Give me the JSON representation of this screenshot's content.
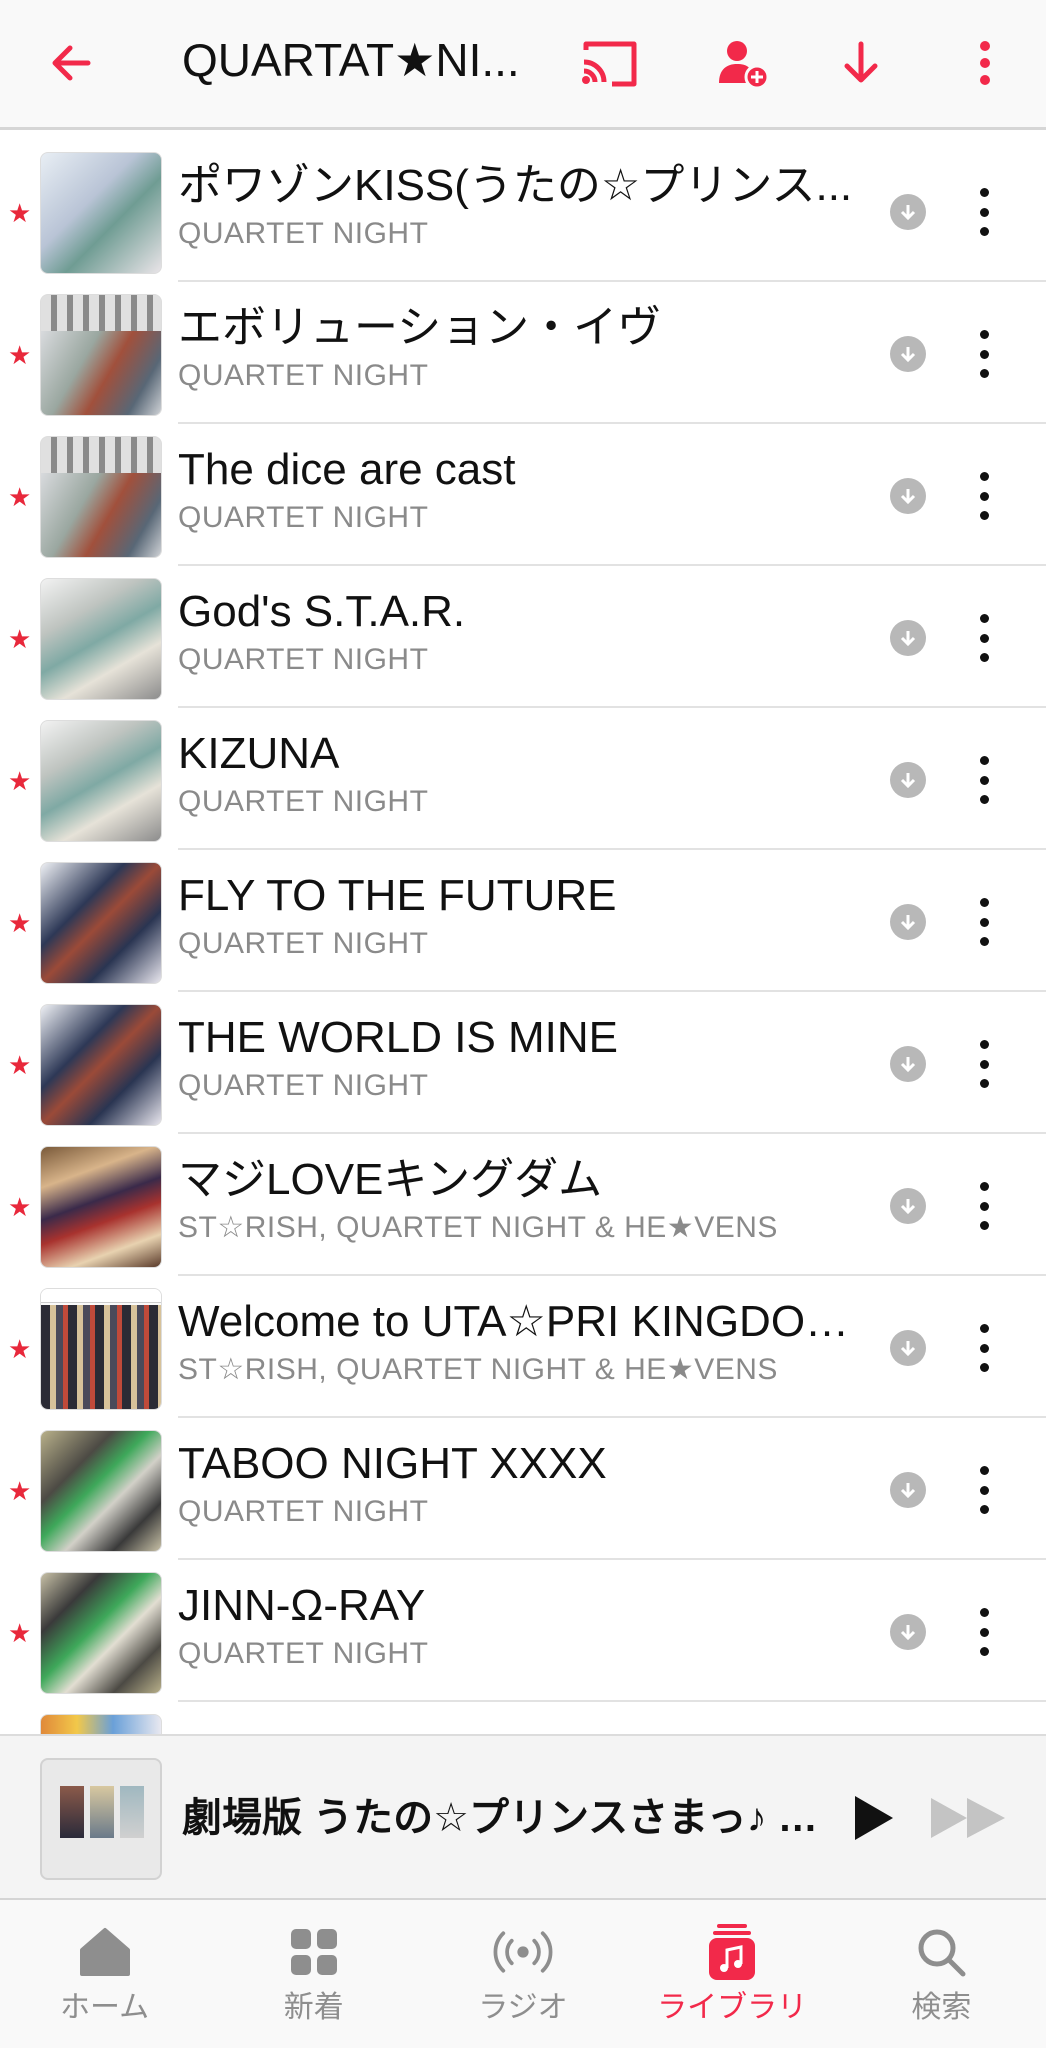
{
  "colors": {
    "accent": "#f2294a",
    "star": "#e8283b",
    "secondary_text": "#8a8a8a"
  },
  "header": {
    "title": "QUARTAT★NI...",
    "back_icon": "arrow-left-icon",
    "cast_icon": "cast-icon",
    "add_user_icon": "person-add-icon",
    "download_icon": "download-arrow-icon",
    "more_icon": "more-vertical-icon"
  },
  "tracks": [
    {
      "title": "ポワゾンKISS(うたの☆プリンス...",
      "artist": "QUARTET NIGHT"
    },
    {
      "title": "エボリューション・イヴ",
      "artist": "QUARTET NIGHT"
    },
    {
      "title": "The dice are cast",
      "artist": "QUARTET NIGHT"
    },
    {
      "title": "God's S.T.A.R.",
      "artist": "QUARTET NIGHT"
    },
    {
      "title": "KIZUNA",
      "artist": "QUARTET NIGHT"
    },
    {
      "title": "FLY TO THE FUTURE",
      "artist": "QUARTET NIGHT"
    },
    {
      "title": "THE WORLD IS MINE",
      "artist": "QUARTET NIGHT"
    },
    {
      "title": "マジLOVEキングダム",
      "artist": "ST☆RISH, QUARTET NIGHT & HE★VENS"
    },
    {
      "title": "Welcome to UTA☆PRI KINGDOM!!",
      "artist": "ST☆RISH, QUARTET NIGHT & HE★VENS"
    },
    {
      "title": "TABOO NIGHT XXXX",
      "artist": "QUARTET NIGHT"
    },
    {
      "title": "JINN-Ω-RAY",
      "artist": "QUARTET NIGHT"
    }
  ],
  "mini_player": {
    "title": "劇場版 うたの☆プリンスさまっ♪ T...",
    "play_icon": "play-icon",
    "forward_icon": "fast-forward-icon"
  },
  "tabs": [
    {
      "label": "ホーム",
      "icon": "home-icon",
      "active": false
    },
    {
      "label": "新着",
      "icon": "grid-icon",
      "active": false
    },
    {
      "label": "ラジオ",
      "icon": "radio-icon",
      "active": false
    },
    {
      "label": "ライブラリ",
      "icon": "library-icon",
      "active": true
    },
    {
      "label": "検索",
      "icon": "search-icon",
      "active": false
    }
  ]
}
